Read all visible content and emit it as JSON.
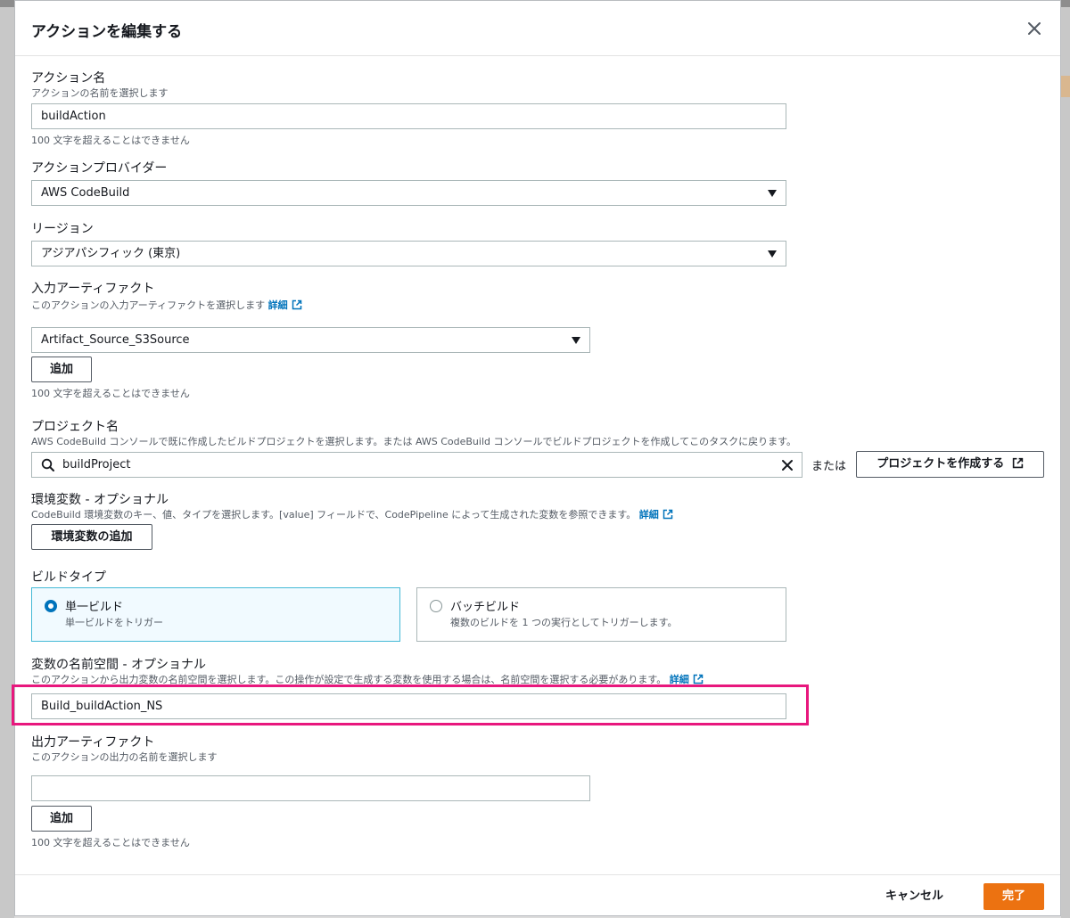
{
  "modal": {
    "title": "アクションを編集する"
  },
  "action_name": {
    "label": "アクション名",
    "description": "アクションの名前を選択します",
    "value": "buildAction",
    "hint": "100 文字を超えることはできません"
  },
  "action_provider": {
    "label": "アクションプロバイダー",
    "selected": "AWS CodeBuild"
  },
  "region": {
    "label": "リージョン",
    "selected": "アジアパシフィック (東京)"
  },
  "input_artifacts": {
    "label": "入力アーティファクト",
    "description": "このアクションの入力アーティファクトを選択します",
    "link": "詳細",
    "selected": "Artifact_Source_S3Source",
    "add_label": "追加",
    "hint": "100 文字を超えることはできません"
  },
  "project_name": {
    "label": "プロジェクト名",
    "description": "AWS CodeBuild コンソールで既に作成したビルドプロジェクトを選択します。または AWS CodeBuild コンソールでビルドプロジェクトを作成してこのタスクに戻ります。",
    "value": "buildProject",
    "or_label": "または",
    "create_label": "プロジェクトを作成する"
  },
  "env_vars": {
    "label": "環境変数 - オプショナル",
    "description": "CodeBuild 環境変数のキー、値、タイプを選択します。[value] フィールドで、CodePipeline によって生成された変数を参照できます。",
    "link": "詳細",
    "add_label": "環境変数の追加"
  },
  "build_type": {
    "label": "ビルドタイプ",
    "options": [
      {
        "title": "単一ビルド",
        "description": "単一ビルドをトリガー",
        "selected": true
      },
      {
        "title": "バッチビルド",
        "description": "複数のビルドを 1 つの実行としてトリガーします。",
        "selected": false
      }
    ]
  },
  "variable_namespace": {
    "label": "変数の名前空間 - オプショナル",
    "description": "このアクションから出力変数の名前空間を選択します。この操作が設定で生成する変数を使用する場合は、名前空間を選択する必要があります。",
    "link": "詳細",
    "value": "Build_buildAction_NS"
  },
  "output_artifacts": {
    "label": "出力アーティファクト",
    "description": "このアクションの出力の名前を選択します",
    "value": "",
    "add_label": "追加",
    "hint": "100 文字を超えることはできません"
  },
  "footer": {
    "cancel_label": "キャンセル",
    "done_label": "完了"
  },
  "colors": {
    "primary": "#ec7211",
    "link": "#0073bb",
    "highlight": "#e8177d",
    "selected_card_bg": "#f1faff",
    "selected_card_border": "#44b9d6"
  }
}
